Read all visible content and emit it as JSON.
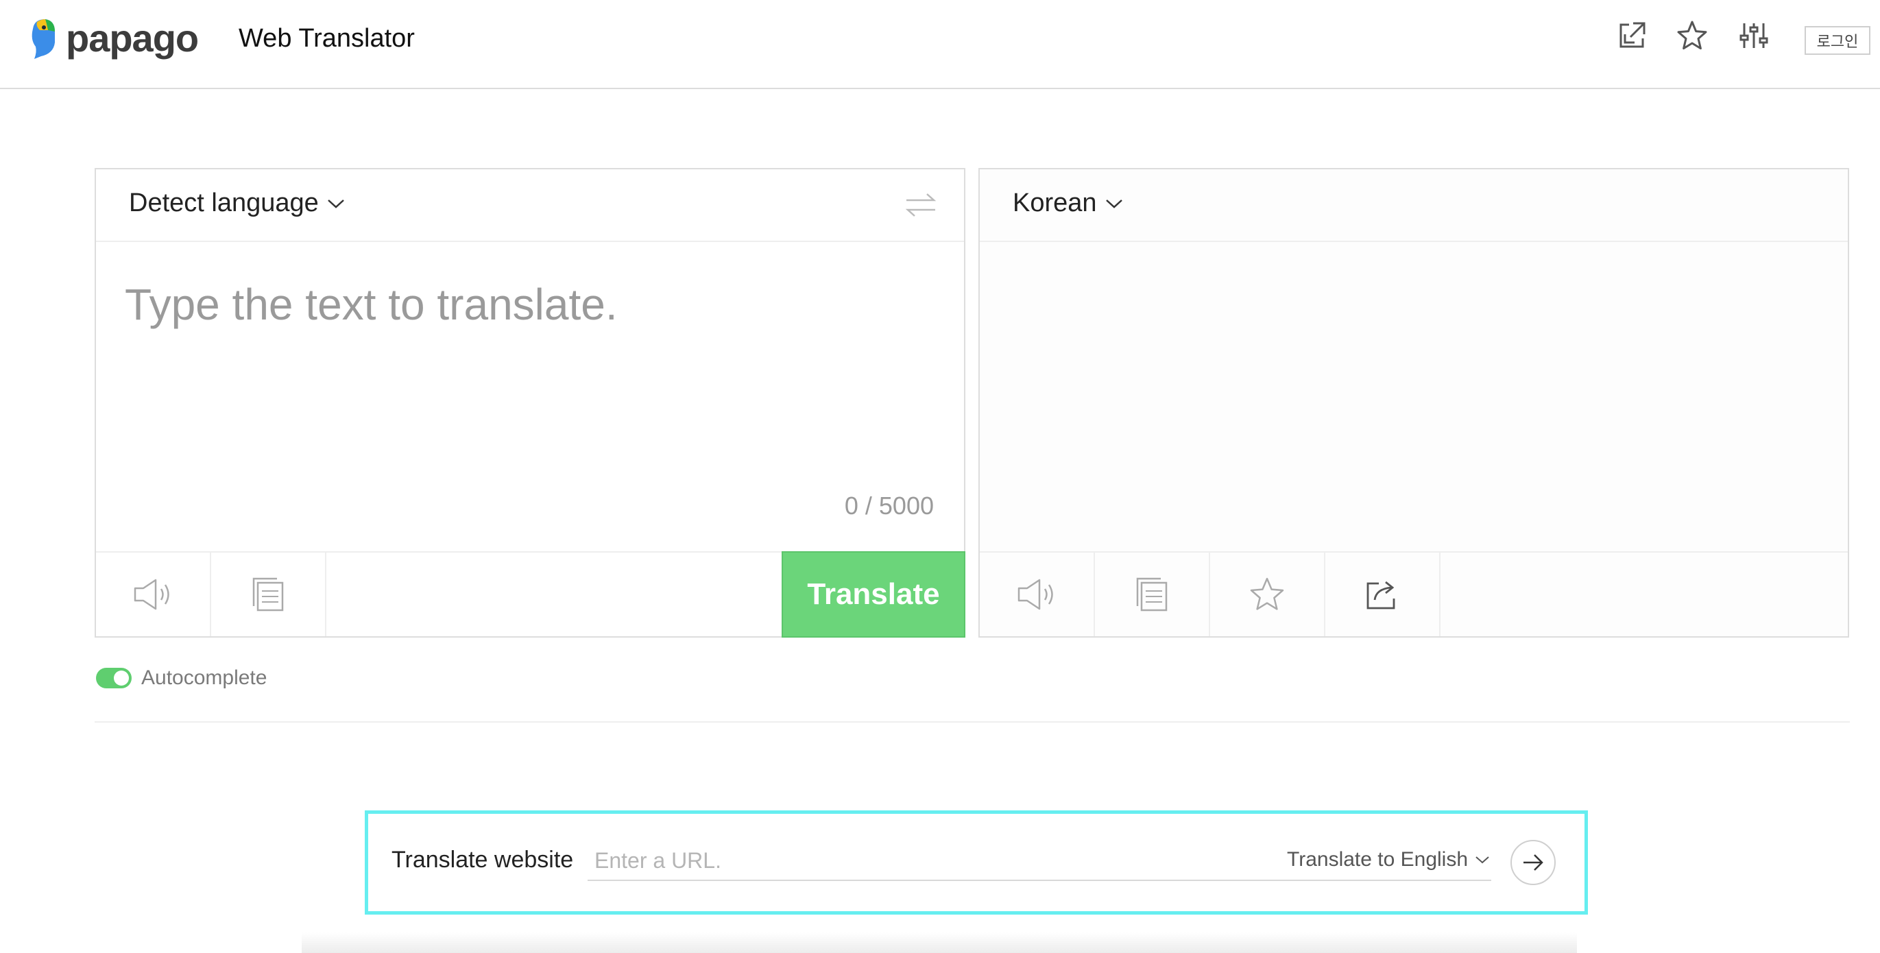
{
  "header": {
    "logo_text": "papago",
    "title": "Web Translator",
    "icons": [
      "external-link-icon",
      "star-icon",
      "settings-sliders-icon"
    ],
    "login_label": "로그인"
  },
  "source": {
    "language": "Detect language",
    "placeholder": "Type the text to translate.",
    "counter": "0 / 5000",
    "translate_label": "Translate",
    "icons": [
      "speaker-icon",
      "copy-icon"
    ]
  },
  "target": {
    "language": "Korean",
    "icons": [
      "speaker-icon",
      "copy-icon",
      "star-icon",
      "share-icon"
    ]
  },
  "autocomplete": {
    "label": "Autocomplete",
    "enabled": true
  },
  "website": {
    "label": "Translate website",
    "url_placeholder": "Enter a URL.",
    "url_value": "",
    "target_language": "Translate to English"
  },
  "colors": {
    "accent_green": "#6bd57a",
    "highlight_cyan": "#66eef0"
  }
}
